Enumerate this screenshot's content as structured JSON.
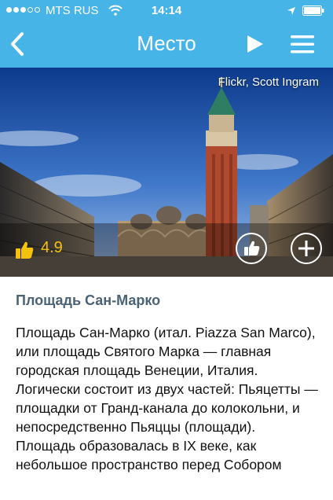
{
  "status_bar": {
    "carrier": "MTS RUS",
    "time": "14:14",
    "signal_bars_filled": 3,
    "signal_bars_total": 5
  },
  "nav": {
    "title": "Место",
    "back_icon": "chevron-left-icon",
    "play_icon": "play-icon",
    "menu_icon": "hamburger-menu-icon"
  },
  "hero": {
    "credit": "Flickr, Scott Ingram",
    "rating": "4.9",
    "rating_icon": "thumbs-up-icon",
    "like_icon": "thumbs-up-icon",
    "add_icon": "plus-icon"
  },
  "article": {
    "title": "Площадь Сан-Марко",
    "body": "Площадь Сан-Марко (итал. Piazza San Marco), или площадь Святого Марка — главная городская площадь Венеции, Италия. Логически состоит из двух частей: Пьяцетты — площадки от Гранд-канала до колокольни, и непосредственно Пьяццы (площади).\nПлощадь образовалась в IX веке, как небольшое пространство перед Собором"
  },
  "colors": {
    "nav_bar": "#46b4e6",
    "title_text": "#4a6275",
    "rating_text": "#f4c20d"
  }
}
